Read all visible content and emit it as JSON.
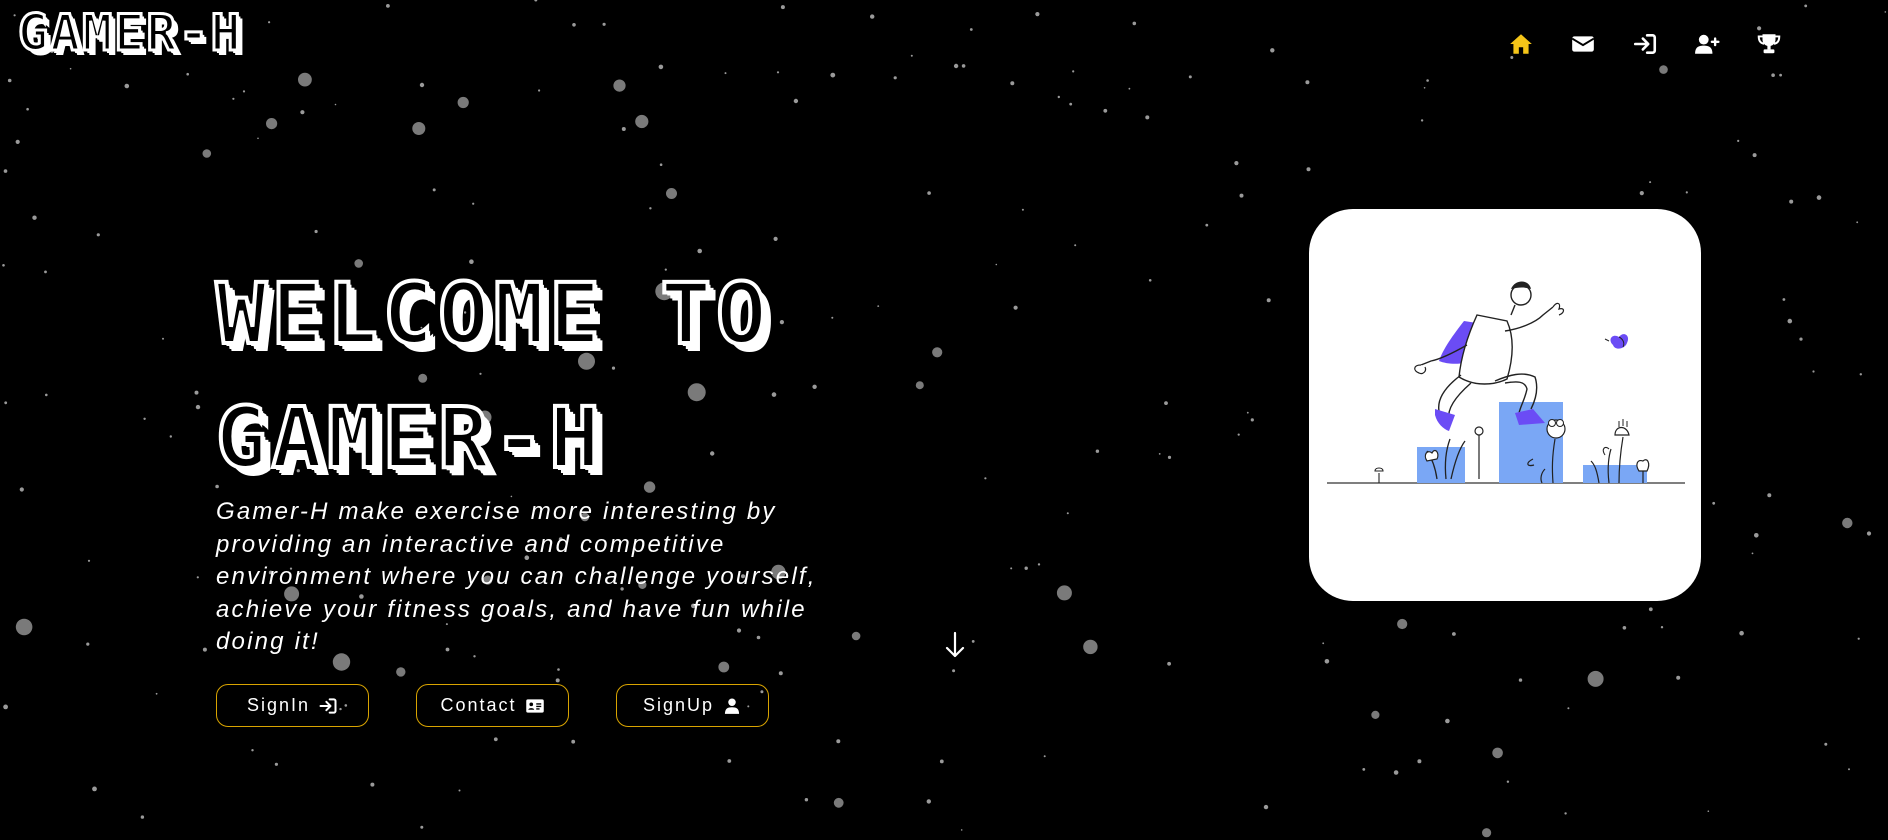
{
  "header": {
    "logo_text": "GAMER-H",
    "nav": [
      {
        "name": "home",
        "icon": "home-icon",
        "color": "#f5c518"
      },
      {
        "name": "contact",
        "icon": "envelope-icon",
        "color": "#ffffff"
      },
      {
        "name": "signin",
        "icon": "sign-in-icon",
        "color": "#ffffff"
      },
      {
        "name": "signup",
        "icon": "user-plus-icon",
        "color": "#ffffff"
      },
      {
        "name": "leaderboard",
        "icon": "trophy-icon",
        "color": "#ffffff"
      }
    ]
  },
  "hero": {
    "title_line1": "WELCOME TO",
    "title_line2": "GAMER-H",
    "description": "Gamer-H make exercise more interesting by providing an interactive and competitive environment where you can challenge yourself, achieve your fitness goals, and have fun while doing it!",
    "buttons": {
      "signin_label": "SignIn",
      "contact_label": "Contact",
      "signup_label": "SignUp"
    }
  },
  "theme": {
    "background": "#000000",
    "accent": "#f5c518",
    "button_border": "#d9a400",
    "illustration_accent": "#6b4cf5",
    "illustration_blocks": "#7aa7f5"
  }
}
